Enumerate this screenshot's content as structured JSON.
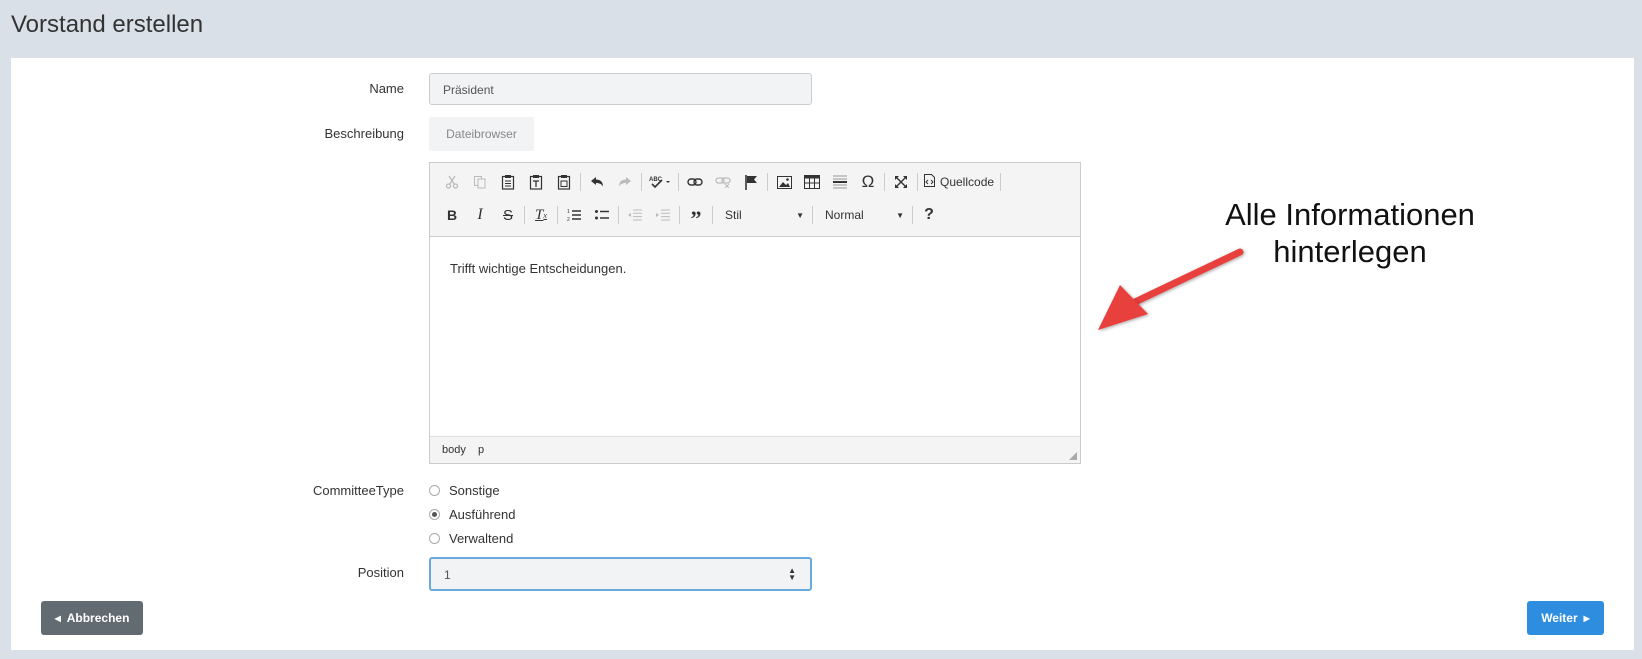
{
  "page": {
    "title": "Vorstand erstellen"
  },
  "form": {
    "name_label": "Name",
    "name_value": "Präsident",
    "description_label": "Beschreibung",
    "file_browser_label": "Dateibrowser",
    "committee_type_label": "CommitteeType",
    "committee_type_options": [
      "Sonstige",
      "Ausführend",
      "Verwaltend"
    ],
    "committee_type_selected": "Ausführend",
    "position_label": "Position",
    "position_value": "1"
  },
  "editor": {
    "source_label": "Quellcode",
    "style_combo": "Stil",
    "format_combo": "Normal",
    "content": "Trifft wichtige Entscheidungen.",
    "path": [
      "body",
      "p"
    ],
    "toolbar_row1_icons": [
      "cut-icon",
      "copy-icon",
      "paste-icon",
      "paste-text-icon",
      "paste-word-icon",
      "undo-icon",
      "redo-icon",
      "spellcheck-icon",
      "link-icon",
      "unlink-icon",
      "anchor-icon",
      "image-icon",
      "table-icon",
      "horizontal-line-icon",
      "special-char-icon",
      "maximize-icon",
      "source-icon"
    ],
    "toolbar_row2_icons": [
      "bold-icon",
      "italic-icon",
      "strike-icon",
      "remove-format-icon",
      "numbered-list-icon",
      "bulleted-list-icon",
      "outdent-icon",
      "indent-icon",
      "blockquote-icon",
      "help-icon"
    ]
  },
  "actions": {
    "back_label": "Abbrechen",
    "next_label": "Weiter"
  },
  "annotation": {
    "line1": "Alle Informationen",
    "line2": "hinterlegen"
  },
  "colors": {
    "background": "#d9e0e8",
    "primary": "#2e8ddf",
    "secondary": "#636b72",
    "annotation_arrow": "#e8413c"
  }
}
